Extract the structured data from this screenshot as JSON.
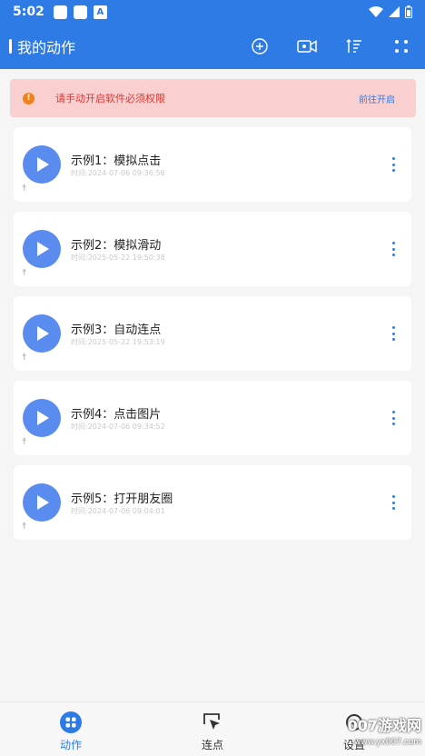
{
  "status_bar": {
    "time": "5:02",
    "badge": "A"
  },
  "app_bar": {
    "title": "我的动作",
    "actions": [
      "add-circle-icon",
      "video-camera-icon",
      "sort-icon",
      "grid-dots-icon"
    ]
  },
  "alert": {
    "icon": "!",
    "message": "请手动开启软件必须权限",
    "link": "前往开启"
  },
  "actions": [
    {
      "title": "示例1：模拟点击",
      "time": "时间:2024-07-06 09:36:56"
    },
    {
      "title": "示例2：模拟滑动",
      "time": "时间:2025-05-22 19:50:38"
    },
    {
      "title": "示例3：自动连点",
      "time": "时间:2025-05-22 19:53:19"
    },
    {
      "title": "示例4：点击图片",
      "time": "时间:2024-07-06 09:34:52"
    },
    {
      "title": "示例5：打开朋友圈",
      "time": "时间:2024-07-06 09:04:01"
    }
  ],
  "bottom_nav": {
    "items": [
      {
        "label": "动作",
        "icon": "grid-icon",
        "active": true
      },
      {
        "label": "连点",
        "icon": "cursor-click-icon",
        "active": false
      },
      {
        "label": "设置",
        "icon": "settings-icon",
        "active": false
      }
    ]
  },
  "watermark": {
    "text": "007游戏网",
    "sub": "www.yx007.com"
  },
  "colors": {
    "primary": "#2f7be6",
    "alert_bg": "#f9cfd0",
    "alert_text": "#e0352f",
    "play": "#5a8cf0"
  }
}
